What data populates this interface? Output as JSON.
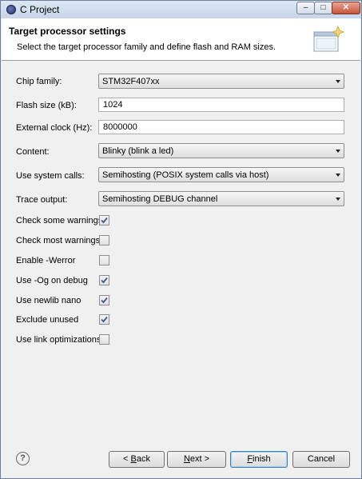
{
  "window": {
    "title": "C Project",
    "min_glyph": "–",
    "max_glyph": "□",
    "close_glyph": "✕"
  },
  "header": {
    "title": "Target processor settings",
    "description": "Select the target processor family and define flash and RAM sizes."
  },
  "form": {
    "chip_family": {
      "label": "Chip family:",
      "value": "STM32F407xx"
    },
    "flash_size": {
      "label": "Flash size (kB):",
      "value": "1024"
    },
    "external_clock": {
      "label": "External clock (Hz):",
      "value": "8000000"
    },
    "content": {
      "label": "Content:",
      "value": "Blinky (blink a led)"
    },
    "system_calls": {
      "label": "Use system calls:",
      "value": "Semihosting (POSIX system calls via host)"
    },
    "trace_output": {
      "label": "Trace output:",
      "value": "Semihosting DEBUG channel"
    },
    "checkboxes": [
      {
        "label": "Check some warnings",
        "checked": true
      },
      {
        "label": "Check most warnings",
        "checked": false
      },
      {
        "label": "Enable -Werror",
        "checked": false
      },
      {
        "label": "Use -Og on debug",
        "checked": true
      },
      {
        "label": "Use newlib nano",
        "checked": true
      },
      {
        "label": "Exclude unused",
        "checked": true
      },
      {
        "label": "Use link optimizations",
        "checked": false
      }
    ]
  },
  "footer": {
    "help_glyph": "?",
    "back": {
      "pre": "< ",
      "mnemonic": "B",
      "post": "ack"
    },
    "next": {
      "mnemonic": "N",
      "post": "ext >"
    },
    "finish": {
      "mnemonic": "F",
      "post": "inish"
    },
    "cancel": {
      "label": "Cancel"
    }
  },
  "colors": {
    "check_mark": "#3a5a99",
    "default_button_border": "#3c7fb1"
  },
  "icons": {
    "header_graphic": "wizard-window-sparkle-icon",
    "app": "eclipse-icon",
    "help": "help-icon"
  }
}
